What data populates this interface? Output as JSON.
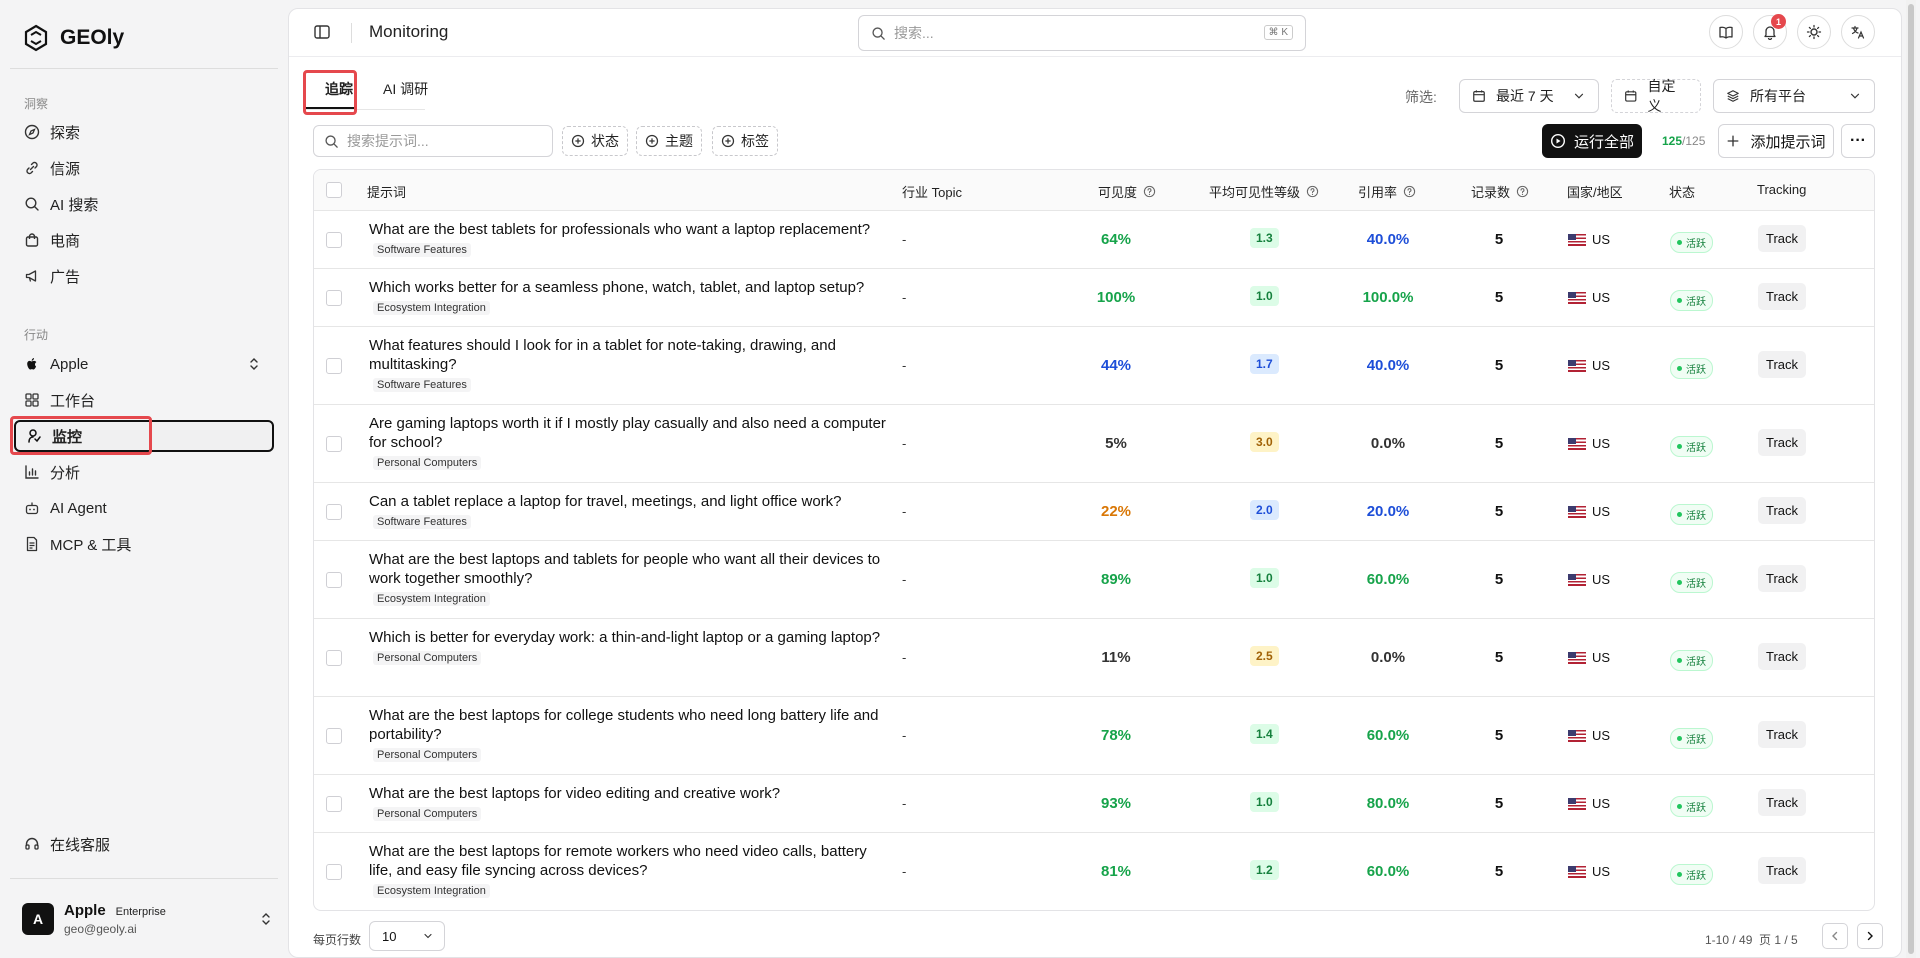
{
  "app": {
    "name": "GEOly"
  },
  "sidebar": {
    "section_insights": "洞察",
    "insights": [
      {
        "label": "探索",
        "icon": "compass-icon"
      },
      {
        "label": "信源",
        "icon": "link-icon"
      },
      {
        "label": "AI 搜索",
        "icon": "search-icon"
      },
      {
        "label": "电商",
        "icon": "shopping-bag-icon"
      },
      {
        "label": "广告",
        "icon": "megaphone-icon"
      }
    ],
    "section_actions": "行动",
    "brand": "Apple",
    "actions": [
      {
        "label": "工作台",
        "icon": "grid-icon"
      },
      {
        "label": "监控",
        "icon": "monitor-icon",
        "active": true
      },
      {
        "label": "分析",
        "icon": "bar-chart-icon"
      },
      {
        "label": "AI Agent",
        "icon": "bot-icon"
      },
      {
        "label": "MCP & 工具",
        "icon": "file-tool-icon"
      }
    ],
    "support": "在线客服",
    "user": {
      "initial": "A",
      "name": "Apple",
      "plan": "Enterprise",
      "email": "geo@geoly.ai"
    }
  },
  "topbar": {
    "title": "Monitoring",
    "search_placeholder": "搜索...",
    "shortcut": "⌘ K",
    "notification_count": "1"
  },
  "tabs": [
    {
      "label": "追踪",
      "active": true
    },
    {
      "label": "AI 调研"
    }
  ],
  "filters": {
    "label": "筛选:",
    "date_range": "最近 7 天",
    "custom": "自定义",
    "platform": "所有平台"
  },
  "toolbar": {
    "search_placeholder": "搜索提示词...",
    "chip_status": "状态",
    "chip_topic": "主题",
    "chip_tag": "标签",
    "run_all": "运行全部",
    "count_active": "125",
    "count_total": "/125",
    "add_prompt": "添加提示词",
    "more": "···"
  },
  "table": {
    "headers": {
      "prompt": "提示词",
      "topic": "行业 Topic",
      "visibility": "可见度",
      "avg_level": "平均可见性等级",
      "citation": "引用率",
      "records": "记录数",
      "country": "国家/地区",
      "status": "状态",
      "tracking": "Tracking"
    },
    "rows": [
      {
        "prompt": "What are the best tablets for professionals who want a laptop replacement?",
        "tag": "Software Features",
        "topic": "-",
        "visibility": "64%",
        "vis_color": "#16a34a",
        "level": "1.3",
        "level_tone": "green",
        "citation": "40.0%",
        "cit_color": "#1d4ed8",
        "records": "5",
        "country": "US",
        "status": "活跃",
        "track": "Track"
      },
      {
        "prompt": "Which works better for a seamless phone, watch, tablet, and laptop setup?",
        "tag": "Ecosystem Integration",
        "topic": "-",
        "visibility": "100%",
        "vis_color": "#16a34a",
        "level": "1.0",
        "level_tone": "green",
        "citation": "100.0%",
        "cit_color": "#16a34a",
        "records": "5",
        "country": "US",
        "status": "活跃",
        "track": "Track"
      },
      {
        "prompt": "What features should I look for in a tablet for note-taking, drawing, and multitasking?",
        "tag": "Software Features",
        "topic": "-",
        "visibility": "44%",
        "vis_color": "#1d4ed8",
        "level": "1.7",
        "level_tone": "blue",
        "citation": "40.0%",
        "cit_color": "#1d4ed8",
        "records": "5",
        "country": "US",
        "status": "活跃",
        "track": "Track"
      },
      {
        "prompt": "Are gaming laptops worth it if I mostly play casually and also need a computer for school?",
        "tag": "Personal Computers",
        "topic": "-",
        "visibility": "5%",
        "vis_color": "#333333",
        "level": "3.0",
        "level_tone": "yellow",
        "citation": "0.0%",
        "cit_color": "#333333",
        "records": "5",
        "country": "US",
        "status": "活跃",
        "track": "Track"
      },
      {
        "prompt": "Can a tablet replace a laptop for travel, meetings, and light office work?",
        "tag": "Software Features",
        "topic": "-",
        "visibility": "22%",
        "vis_color": "#d97706",
        "level": "2.0",
        "level_tone": "blue",
        "citation": "20.0%",
        "cit_color": "#1d4ed8",
        "records": "5",
        "country": "US",
        "status": "活跃",
        "track": "Track"
      },
      {
        "prompt": "What are the best laptops and tablets for people who want all their devices to work together smoothly?",
        "tag": "Ecosystem Integration",
        "topic": "-",
        "visibility": "89%",
        "vis_color": "#16a34a",
        "level": "1.0",
        "level_tone": "green",
        "citation": "60.0%",
        "cit_color": "#16a34a",
        "records": "5",
        "country": "US",
        "status": "活跃",
        "track": "Track"
      },
      {
        "prompt": "Which is better for everyday work: a thin-and-light laptop or a gaming laptop?",
        "tag": "Personal Computers",
        "topic": "-",
        "visibility": "11%",
        "vis_color": "#333333",
        "level": "2.5",
        "level_tone": "yellow",
        "citation": "0.0%",
        "cit_color": "#333333",
        "records": "5",
        "country": "US",
        "status": "活跃",
        "track": "Track"
      },
      {
        "prompt": "What are the best laptops for college students who need long battery life and portability?",
        "tag": "Personal Computers",
        "topic": "-",
        "visibility": "78%",
        "vis_color": "#16a34a",
        "level": "1.4",
        "level_tone": "green",
        "citation": "60.0%",
        "cit_color": "#16a34a",
        "records": "5",
        "country": "US",
        "status": "活跃",
        "track": "Track"
      },
      {
        "prompt": "What are the best laptops for video editing and creative work?",
        "tag": "Personal Computers",
        "topic": "-",
        "visibility": "93%",
        "vis_color": "#16a34a",
        "level": "1.0",
        "level_tone": "green",
        "citation": "80.0%",
        "cit_color": "#16a34a",
        "records": "5",
        "country": "US",
        "status": "活跃",
        "track": "Track"
      },
      {
        "prompt": "What are the best laptops for remote workers who need video calls, battery life, and easy file syncing across devices?",
        "tag": "Ecosystem Integration",
        "topic": "-",
        "visibility": "81%",
        "vis_color": "#16a34a",
        "level": "1.2",
        "level_tone": "green",
        "citation": "60.0%",
        "cit_color": "#16a34a",
        "records": "5",
        "country": "US",
        "status": "活跃",
        "track": "Track"
      }
    ]
  },
  "footer": {
    "rows_label": "每页行数",
    "rows_value": "10",
    "range": "1-10 / 49",
    "page": "页 1 / 5"
  }
}
